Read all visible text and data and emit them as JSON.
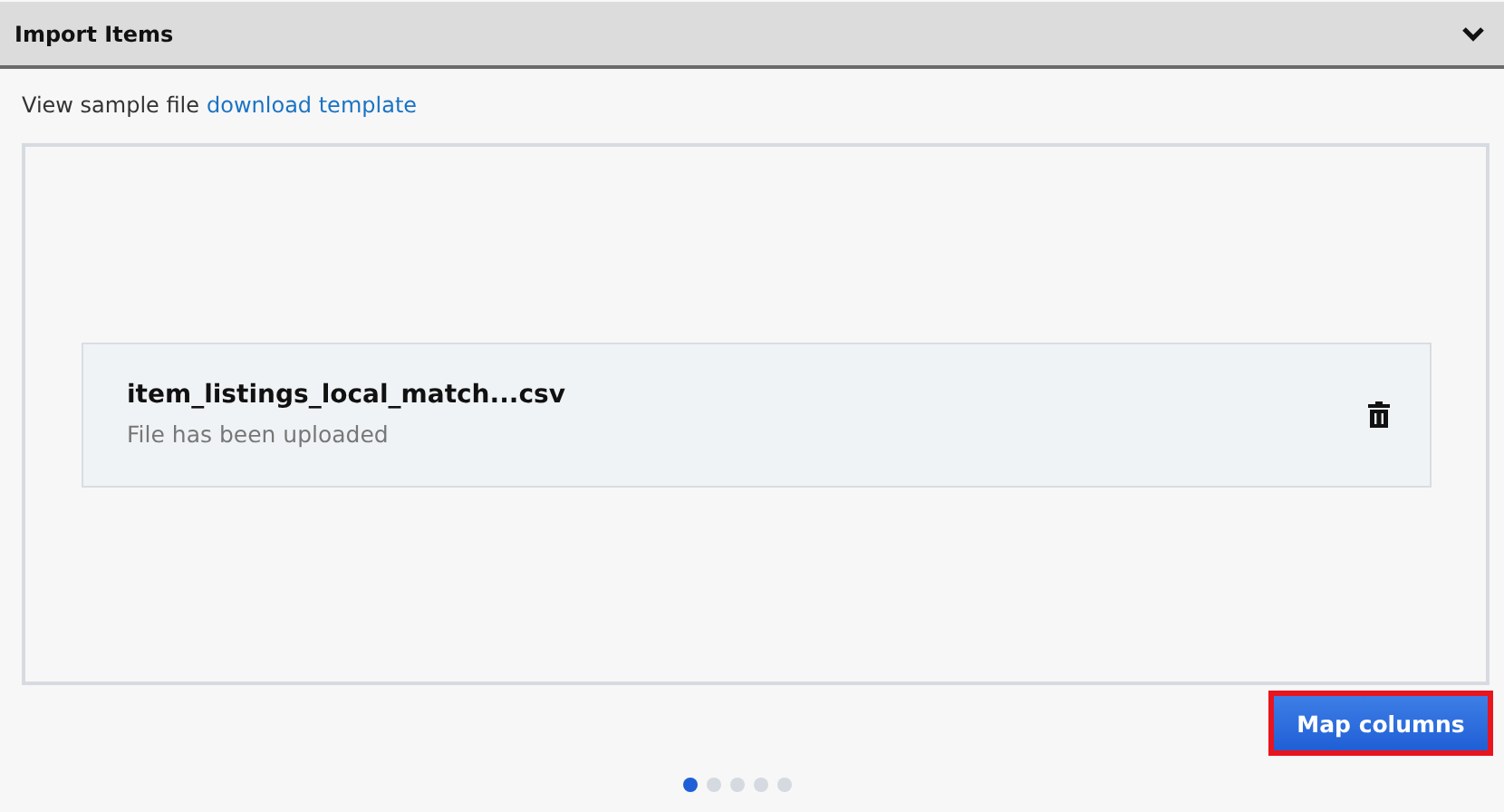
{
  "panel": {
    "title": "Import Items",
    "expanded": true
  },
  "sample": {
    "text": "View sample file",
    "link": "download template"
  },
  "file": {
    "name": "item_listings_local_match...csv",
    "status": "File has been uploaded"
  },
  "action": {
    "label": "Map columns",
    "highlighted": true
  },
  "steps": [
    {
      "selected": true
    },
    {
      "selected": false
    },
    {
      "selected": false
    },
    {
      "selected": false
    },
    {
      "selected": false
    }
  ]
}
